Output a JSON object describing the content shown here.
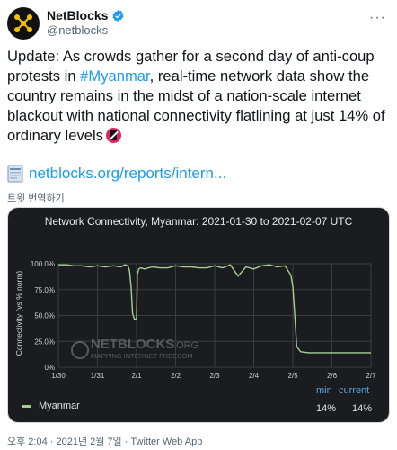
{
  "account": {
    "display_name": "NetBlocks",
    "handle": "@netblocks",
    "more_label": "···",
    "avatar_icon": "netblocks-logo-icon",
    "verified_icon": "verified-badge-icon"
  },
  "tweet": {
    "text_before": "Update: As crowds gather for a second day of anti-coup protests in ",
    "hashtag": "#Myanmar",
    "text_after": ", real-time network data show the country remains in the midst of a nation-scale internet blackout with national connectivity flatlining at just 14% of ordinary levels",
    "emoji_icon": "no-mobile-phones-icon",
    "link_text": "netblocks.org/reports/intern...",
    "link_icon": "page-icon",
    "translate_label": "트윗 번역하기"
  },
  "card": {
    "watermark_brand": "NETBLOCKS",
    "watermark_suffix": ".ORG",
    "watermark_tagline": "MAPPING INTERNET FREEDOM",
    "min_label": "min",
    "current_label": "current",
    "min_value": "14%",
    "current_value": "14%"
  },
  "chart_data": {
    "type": "line",
    "title": "Network Connectivity, Myanmar: 2021-01-30 to 2021-02-07 UTC",
    "xlabel": "",
    "ylabel": "Connectivity (vs % norm)",
    "ylim": [
      0,
      100
    ],
    "yticks": [
      "0%",
      "25.0%",
      "50.0%",
      "75.0%",
      "100.0%"
    ],
    "xticks": [
      "1/30",
      "1/31",
      "2/1",
      "2/2",
      "2/3",
      "2/4",
      "2/5",
      "2/6",
      "2/7"
    ],
    "grid": true,
    "legend": "bottom-left",
    "colors": {
      "series": "#a6ce90",
      "background": "#1b1c1f",
      "grid": "#3a3c40"
    },
    "series": [
      {
        "name": "Myanmar",
        "x": [
          0,
          0.2,
          0.4,
          0.6,
          0.8,
          1.0,
          1.2,
          1.4,
          1.6,
          1.7,
          1.78,
          1.82,
          1.86,
          1.9,
          1.95,
          2.0,
          2.02,
          2.06,
          2.1,
          2.2,
          2.4,
          2.6,
          2.8,
          3.0,
          3.2,
          3.4,
          3.6,
          3.8,
          4.0,
          4.2,
          4.4,
          4.6,
          4.8,
          5.0,
          5.2,
          5.4,
          5.6,
          5.8,
          5.95,
          6.0,
          6.05,
          6.1,
          6.2,
          6.4,
          6.6,
          6.8,
          7.0,
          7.2,
          7.4,
          7.6,
          7.8,
          8.0
        ],
        "values": [
          99,
          99,
          98,
          98,
          97,
          98,
          97,
          98,
          97,
          99,
          98,
          93,
          78,
          52,
          46,
          47,
          90,
          95,
          96,
          95,
          97,
          96,
          96,
          98,
          97,
          97,
          96,
          96,
          98,
          96,
          99,
          88,
          97,
          95,
          98,
          99,
          97,
          98,
          89,
          78,
          50,
          20,
          15,
          14,
          14,
          14,
          14,
          14,
          14,
          14,
          14,
          14
        ]
      }
    ]
  },
  "footer": {
    "timestamp": "오후 2:04 · 2021년 2월 7일 · Twitter Web App"
  }
}
